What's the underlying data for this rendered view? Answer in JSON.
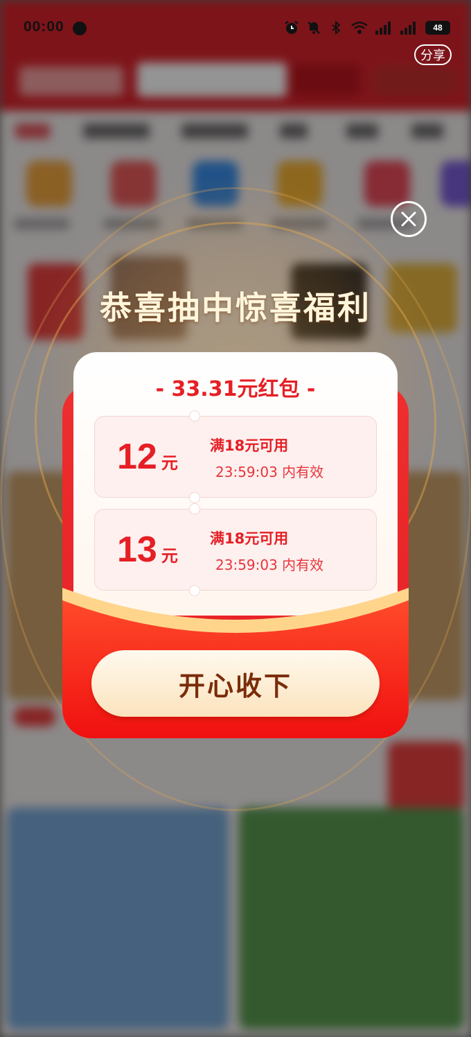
{
  "status_bar": {
    "time": "00:00",
    "battery": "48",
    "icons": [
      "alarm-icon",
      "mute-icon",
      "bluetooth-icon",
      "wifi-icon",
      "signal-5g-icon",
      "signal-5g-icon",
      "battery-icon"
    ]
  },
  "top_bar": {
    "share_label": "分享"
  },
  "modal": {
    "title": "恭喜抽中惊喜福利",
    "envelope_title": "- 33.31元红包 -",
    "coupons": [
      {
        "amount": "12",
        "unit": "元",
        "condition": "满18元可用",
        "expiry": "23:59:03 内有效"
      },
      {
        "amount": "13",
        "unit": "元",
        "condition": "满18元可用",
        "expiry": "23:59:03 内有效"
      }
    ],
    "accept_label": "开心收下",
    "colors": {
      "red": "#e51f25",
      "gold_text": "#fff6dc",
      "button_text": "#7a2c0a"
    }
  }
}
